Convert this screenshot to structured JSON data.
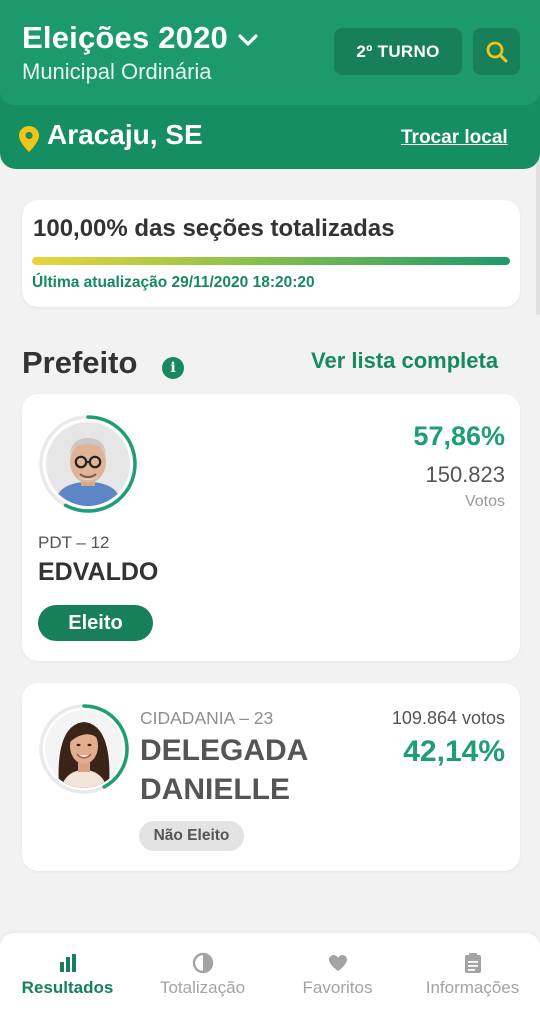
{
  "header": {
    "title": "Eleições 2020",
    "subtitle": "Municipal Ordinária",
    "turno_label": "2º TURNO",
    "icons": {
      "dropdown": "chevron-down-icon",
      "search": "search-icon"
    }
  },
  "location": {
    "name": "Aracaju, SE",
    "change_label": "Trocar local",
    "icon": "map-pin-icon"
  },
  "progress": {
    "title": "100,00% das seções totalizadas",
    "fraction": 1.0,
    "update_text": "Última atualização 29/11/2020 18:20:20"
  },
  "section": {
    "title": "Prefeito",
    "info_icon": "info-icon",
    "link_label": "Ver lista completa"
  },
  "candidates": [
    {
      "party": "PDT – 12",
      "name": "EDVALDO",
      "percent": "57,86%",
      "votes": "150.823",
      "votes_label": "Votos",
      "status": "Eleito",
      "share": 0.5786
    },
    {
      "party": "CIDADANIA – 23",
      "name_line1": "DELEGADA",
      "name_line2": "DANIELLE",
      "percent": "42,14%",
      "votes": "109.864 votos",
      "status": "Não Eleito",
      "share": 0.4214
    }
  ],
  "nav": {
    "items": [
      {
        "label": "Resultados",
        "icon": "bar-chart-icon",
        "active": true
      },
      {
        "label": "Totalização",
        "icon": "pie-chart-icon",
        "active": false
      },
      {
        "label": "Favoritos",
        "icon": "heart-icon",
        "active": false
      },
      {
        "label": "Informações",
        "icon": "clipboard-icon",
        "active": false
      }
    ]
  },
  "colors": {
    "primary": "#1d9a6c",
    "primary_dark": "#17805a",
    "accent_percent": "#1f9e76",
    "pin": "#f0c419"
  }
}
